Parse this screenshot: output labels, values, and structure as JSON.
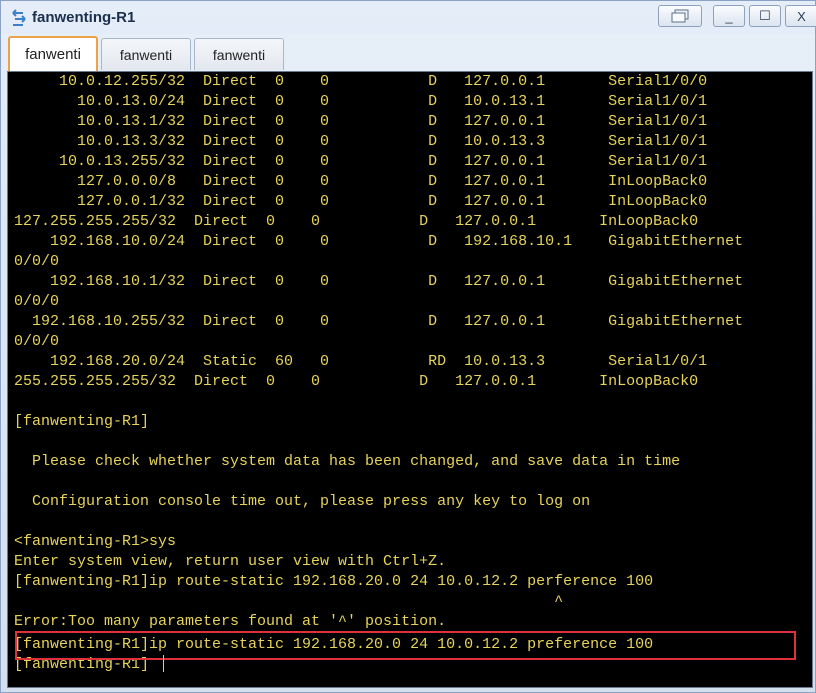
{
  "window": {
    "title": "fanwenting-R1",
    "controls": {
      "minimize": "_",
      "maximize": "☐",
      "close": "X"
    }
  },
  "tabs": [
    {
      "label": "fanwenti",
      "active": true
    },
    {
      "label": "fanwenti",
      "active": false
    },
    {
      "label": "fanwenti",
      "active": false
    }
  ],
  "terminal": {
    "text_color": "#e6d35a",
    "background": "#000000",
    "lines": [
      "     10.0.12.255/32  Direct  0    0           D   127.0.0.1       Serial1/0/0",
      "       10.0.13.0/24  Direct  0    0           D   10.0.13.1       Serial1/0/1",
      "       10.0.13.1/32  Direct  0    0           D   127.0.0.1       Serial1/0/1",
      "       10.0.13.3/32  Direct  0    0           D   10.0.13.3       Serial1/0/1",
      "     10.0.13.255/32  Direct  0    0           D   127.0.0.1       Serial1/0/1",
      "       127.0.0.0/8   Direct  0    0           D   127.0.0.1       InLoopBack0",
      "       127.0.0.1/32  Direct  0    0           D   127.0.0.1       InLoopBack0",
      "127.255.255.255/32  Direct  0    0           D   127.0.0.1       InLoopBack0",
      "    192.168.10.0/24  Direct  0    0           D   192.168.10.1    GigabitEthernet",
      "0/0/0",
      "    192.168.10.1/32  Direct  0    0           D   127.0.0.1       GigabitEthernet",
      "0/0/0",
      "  192.168.10.255/32  Direct  0    0           D   127.0.0.1       GigabitEthernet",
      "0/0/0",
      "    192.168.20.0/24  Static  60   0           RD  10.0.13.3       Serial1/0/1",
      "255.255.255.255/32  Direct  0    0           D   127.0.0.1       InLoopBack0",
      "",
      "[fanwenting-R1]",
      "",
      "  Please check whether system data has been changed, and save data in time",
      "",
      "  Configuration console time out, please press any key to log on",
      "",
      "<fanwenting-R1>sys",
      "Enter system view, return user view with Ctrl+Z.",
      "[fanwenting-R1]ip route-static 192.168.20.0 24 10.0.12.2 perference 100",
      "                                                            ^",
      "Error:Too many parameters found at '^' position.",
      "[fanwenting-R1]ip route-static 192.168.20.0 24 10.0.12.2 preference 100",
      "[fanwenting-R1]"
    ]
  }
}
